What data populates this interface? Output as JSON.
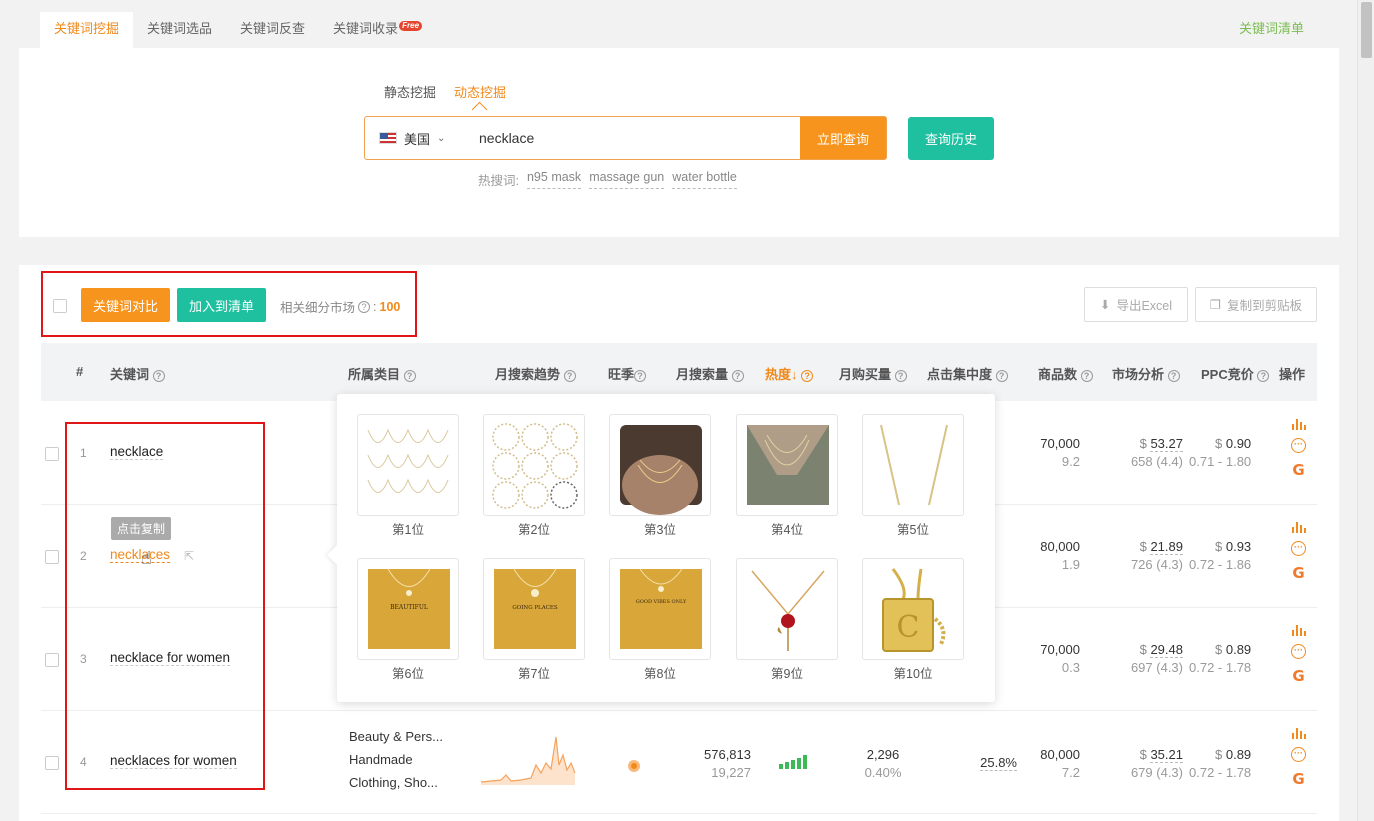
{
  "tabs": [
    {
      "label": "关键词挖掘"
    },
    {
      "label": "关键词选品"
    },
    {
      "label": "关键词反查"
    },
    {
      "label": "关键词收录",
      "badge": "Free"
    }
  ],
  "keyword_list_link": "关键词清单",
  "search": {
    "modes": [
      "静态挖掘",
      "动态挖掘"
    ],
    "country": "美国",
    "value": "necklace",
    "query_button": "立即查询",
    "history_button": "查询历史",
    "hot_label": "热搜词:",
    "hot_words": [
      "n95 mask",
      "massage gun",
      "water bottle"
    ]
  },
  "toolbar": {
    "compare_button": "关键词对比",
    "add_button": "加入到清单",
    "market_label": "相关细分市场",
    "market_count": "100",
    "export_button": "导出Excel",
    "copy_button": "复制到剪贴板"
  },
  "table": {
    "headers": [
      "#",
      "关键词",
      "所属类目",
      "月搜索趋势",
      "旺季",
      "月搜索量",
      "热度↓",
      "月购买量",
      "点击集中度",
      "商品数",
      "市场分析",
      "PPC竞价",
      "操作"
    ],
    "rows": [
      {
        "rank": "1",
        "keyword": "necklace",
        "products": "70,000",
        "products_sub": "9.2",
        "market_price": "53.27",
        "market_sub": "658 (4.4)",
        "ppc": "0.90",
        "ppc_range": "0.71 - 1.80"
      },
      {
        "rank": "2",
        "keyword": "necklaces",
        "products": "80,000",
        "products_sub": "1.9",
        "market_price": "21.89",
        "market_sub": "726 (4.3)",
        "ppc": "0.93",
        "ppc_range": "0.72 - 1.86"
      },
      {
        "rank": "3",
        "keyword": "necklace for women",
        "products": "70,000",
        "products_sub": "0.3",
        "market_price": "29.48",
        "market_sub": "697 (4.3)",
        "ppc": "0.89",
        "ppc_range": "0.72 - 1.78"
      },
      {
        "rank": "4",
        "keyword": "necklaces for women",
        "categories": [
          "Beauty & Pers...",
          "Handmade",
          "Clothing, Sho..."
        ],
        "search_volume": "576,813",
        "search_volume_sub": "19,227",
        "purchases": "2,296",
        "purchase_rate": "0.40%",
        "click_concentration": "25.8%",
        "products": "80,000",
        "products_sub": "7.2",
        "market_price": "35.21",
        "market_sub": "679 (4.3)",
        "ppc": "0.89",
        "ppc_range": "0.72 - 1.78"
      }
    ],
    "copy_tip": "点击复制",
    "currency": "$"
  },
  "popup": {
    "ranks": [
      "第1位",
      "第2位",
      "第3位",
      "第4位",
      "第5位",
      "第6位",
      "第7位",
      "第8位",
      "第9位",
      "第10位"
    ],
    "card_texts": [
      "BEAUTIFUL",
      "GOING PLACES",
      "GOOD VIBES ONLY"
    ]
  },
  "colors": {
    "accent": "#f7941d",
    "teal": "#1fc0a0",
    "highlight_border": "#e01515",
    "green": "#3dba58"
  }
}
